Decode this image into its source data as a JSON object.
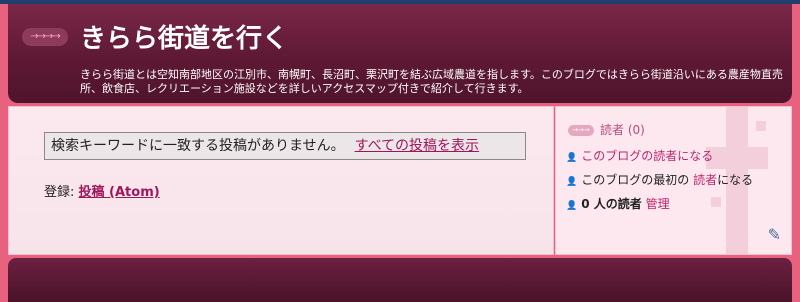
{
  "header": {
    "title": "きらら街道を行く",
    "description": "きらら街道とは空知南部地区の江別市、南幌町、長沼町、栗沢町を結ぶ広域農道を指します。このブログではきらら街道沿いにある農産物直売所、飲食店、レクリエーション施設などを詳しいアクセスマップ付きで紹介して行きます。"
  },
  "main": {
    "notice_text": "検索キーワードに一致する投稿がありません。",
    "show_all_link": "すべての投稿を表示",
    "feed_label": "登録:",
    "feed_link": "投稿 (Atom)"
  },
  "sidebar": {
    "heading": "読者 (0)",
    "become_reader": "このブログの読者になる",
    "first_reader_prefix": "このブログの最初の",
    "first_reader_link": "読者",
    "first_reader_suffix": "になる",
    "reader_count": "0 人の読者",
    "manage": "管理"
  },
  "colors": {
    "accent": "#a0155c",
    "header_bg": "#5e1934",
    "page_bg": "#e8617f"
  }
}
